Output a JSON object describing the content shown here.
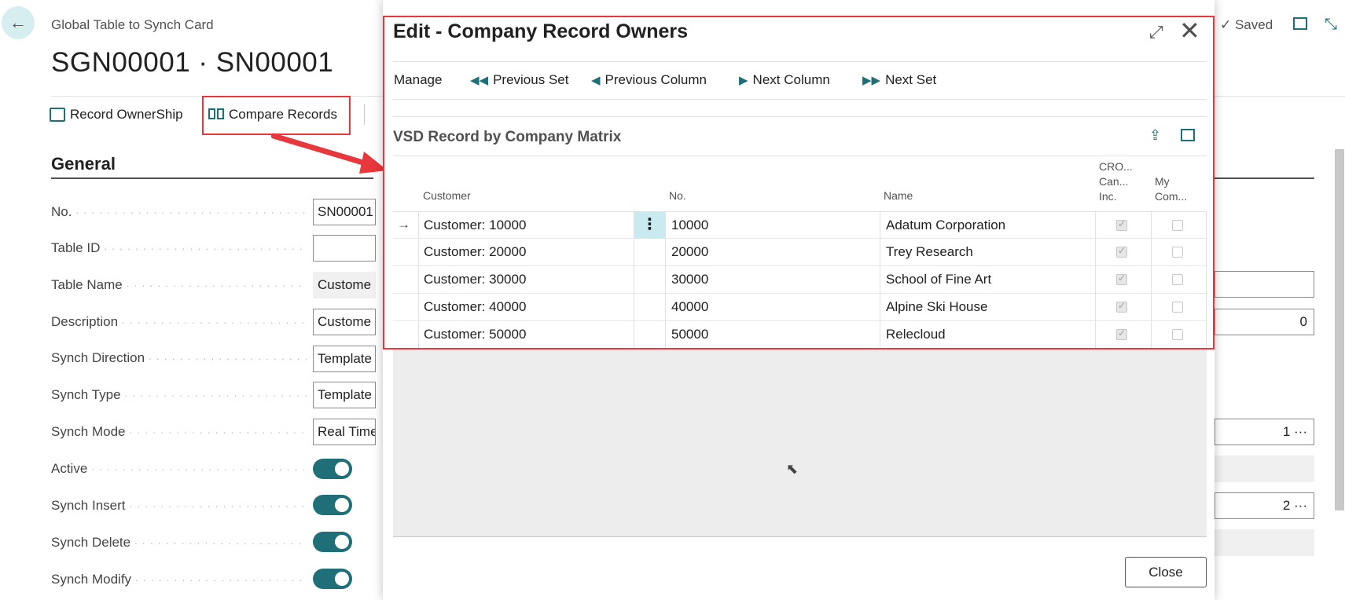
{
  "page": {
    "caption": "Global Table to Synch Card",
    "title": "SGN00001 · SN00001",
    "saved": "Saved"
  },
  "actions": {
    "record_ownership": "Record OwnerShip",
    "compare_records": "Compare Records"
  },
  "general": {
    "title": "General",
    "fields": [
      {
        "label": "No.",
        "value": "SN00001"
      },
      {
        "label": "Table ID",
        "value": ""
      },
      {
        "label": "Table Name",
        "value": "Custome"
      },
      {
        "label": "Description",
        "value": "Custome"
      },
      {
        "label": "Synch Direction",
        "value": "Template"
      },
      {
        "label": "Synch Type",
        "value": "Template"
      },
      {
        "label": "Synch Mode",
        "value": "Real Time"
      }
    ],
    "toggles": [
      {
        "label": "Active",
        "on": true
      },
      {
        "label": "Synch Insert",
        "on": true
      },
      {
        "label": "Synch Delete",
        "on": true
      },
      {
        "label": "Synch Modify",
        "on": true
      }
    ]
  },
  "right_panel": {
    "value_0": "0",
    "value_1": "1",
    "value_2": "2",
    "more": "···"
  },
  "dialog": {
    "title": "Edit - Company Record Owners",
    "menu": {
      "manage": "Manage",
      "previous_set": "Previous Set",
      "previous_column": "Previous Column",
      "next_column": "Next Column",
      "next_set": "Next Set"
    },
    "part_title": "VSD Record by Company Matrix",
    "columns": {
      "customer": "Customer",
      "no": "No.",
      "name": "Name",
      "cro_line1": "CRO...",
      "cro_line2": "Can...",
      "cro_line3": "Inc.",
      "my_line1": "My",
      "my_line2": "Com..."
    },
    "rows": [
      {
        "customer": "Customer: 10000",
        "no": "10000",
        "name": "Adatum Corporation",
        "cro": true,
        "my": false
      },
      {
        "customer": "Customer: 20000",
        "no": "20000",
        "name": "Trey Research",
        "cro": true,
        "my": false
      },
      {
        "customer": "Customer: 30000",
        "no": "30000",
        "name": "School of Fine Art",
        "cro": true,
        "my": false
      },
      {
        "customer": "Customer: 40000",
        "no": "40000",
        "name": "Alpine Ski House",
        "cro": true,
        "my": false
      },
      {
        "customer": "Customer: 50000",
        "no": "50000",
        "name": "Relecloud",
        "cro": true,
        "my": false
      }
    ],
    "close_label": "Close"
  },
  "colors": {
    "accent": "#1f6f78",
    "highlight": "#e8373d",
    "selected_cell": "#c9eaf0"
  }
}
